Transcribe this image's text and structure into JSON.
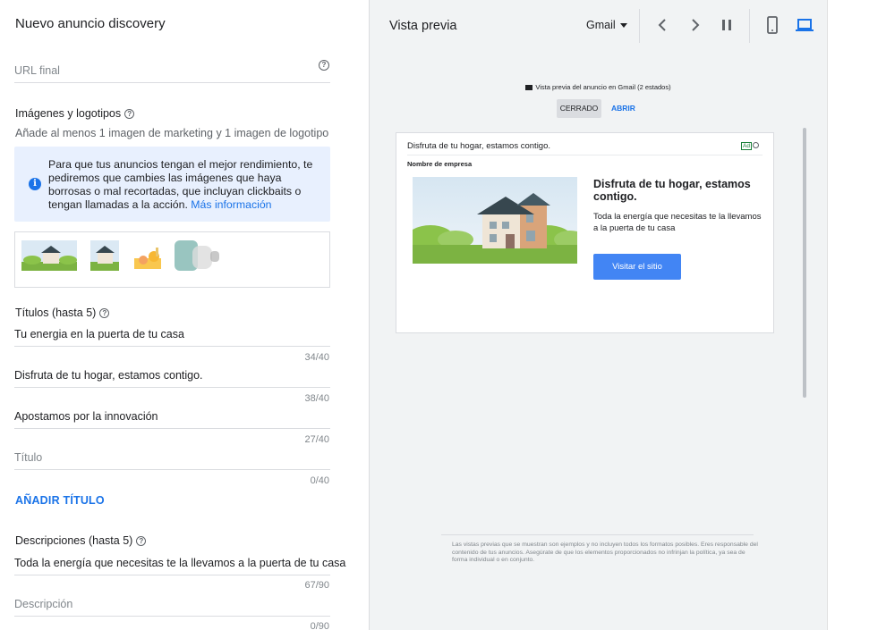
{
  "editor": {
    "title": "Nuevo anuncio discovery",
    "final_url": {
      "placeholder": "URL final",
      "value": ""
    },
    "images": {
      "label": "Imágenes y logotipos",
      "hint": "Añade al menos 1 imagen de marketing y 1 imagen de logotipo",
      "info_text": "Para que tus anuncios tengan el mejor rendimiento, te pediremos que cambies las imágenes que haya borrosas o mal recortadas, que incluyan clickbaits o tengan llamadas a la acción.",
      "info_link": "Más información"
    },
    "titles": {
      "label": "Títulos (hasta 5)",
      "items": [
        {
          "value": "Tu energia en la puerta de tu casa",
          "counter": "34/40"
        },
        {
          "value": "Disfruta de tu hogar, estamos contigo.",
          "counter": "38/40"
        },
        {
          "value": "Apostamos por la innovación",
          "counter": "27/40"
        },
        {
          "value": "",
          "placeholder": "Título",
          "counter": "0/40"
        }
      ],
      "add_label": "AÑADIR TÍTULO"
    },
    "descriptions": {
      "label": "Descripciones (hasta 5)",
      "items": [
        {
          "value": "Toda la energía que necesitas te la llevamos a la puerta de tu casa",
          "counter": "67/90"
        },
        {
          "value": "",
          "placeholder": "Descripción",
          "counter": "0/90"
        }
      ]
    }
  },
  "preview": {
    "title": "Vista previa",
    "platform": "Gmail",
    "caption": "Vista previa del anuncio en Gmail (2 estados)",
    "state_closed": "CERRADO",
    "state_open": "ABRIR",
    "ad": {
      "subject": "Disfruta de tu hogar, estamos contigo.",
      "badge": "Ad",
      "company": "Nombre de empresa",
      "headline": "Disfruta de tu hogar, estamos contigo.",
      "description": "Toda la energía que necesitas te la llevamos a la puerta de tu casa",
      "cta": "Visitar el sitio"
    },
    "disclaimer": "Las vistas previas que se muestran son ejemplos y no incluyen todos los formatos posibles. Eres responsable del contenido de tus anuncios. Asegúrate de que los elementos proporcionados no infrinjan la política, ya sea de forma individual o en conjunto."
  },
  "colors": {
    "accent": "#1a73e8",
    "cta": "#4285f4",
    "info_bg": "#e8f0fe",
    "panel_bg": "#f1f3f4"
  },
  "icons": [
    "help-icon",
    "info-icon",
    "caret-down-icon",
    "chevron-left-icon",
    "chevron-right-icon",
    "pause-icon",
    "mobile-icon",
    "desktop-icon",
    "envelope-icon",
    "ad-info-icon"
  ]
}
